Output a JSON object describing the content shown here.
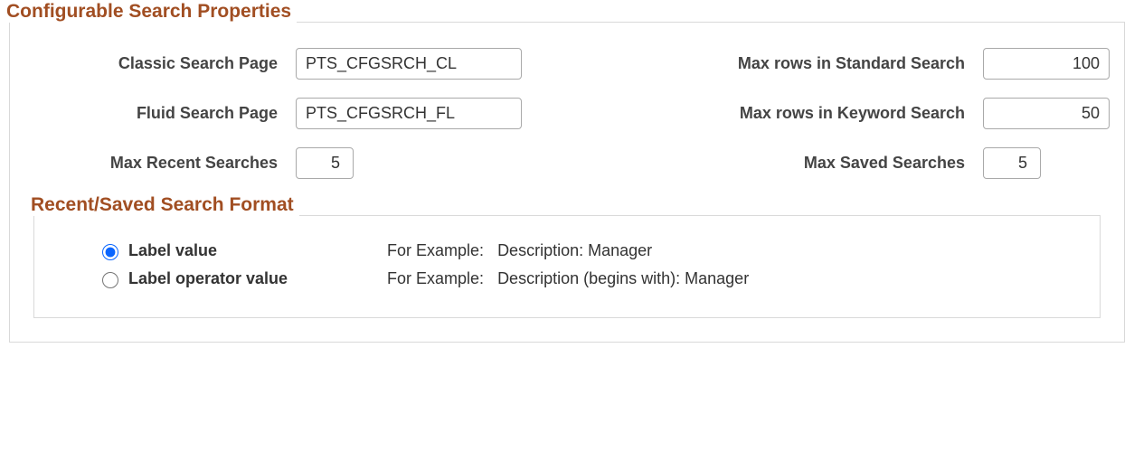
{
  "section_title": "Configurable Search Properties",
  "fields": {
    "classic_label": "Classic Search Page",
    "classic_value": "PTS_CFGSRCH_CL",
    "fluid_label": "Fluid Search Page",
    "fluid_value": "PTS_CFGSRCH_FL",
    "max_recent_label": "Max Recent Searches",
    "max_recent_value": "5",
    "max_std_label": "Max rows in Standard Search",
    "max_std_value": "100",
    "max_kw_label": "Max rows in Keyword Search",
    "max_kw_value": "50",
    "max_saved_label": "Max Saved Searches",
    "max_saved_value": "5"
  },
  "format_section": {
    "title": "Recent/Saved Search Format",
    "options": {
      "label_value": "Label value",
      "label_operator_value": "Label operator value"
    },
    "example_prefix": "For Example:",
    "example1": "Description:  Manager",
    "example2": "Description (begins with):    Manager"
  }
}
